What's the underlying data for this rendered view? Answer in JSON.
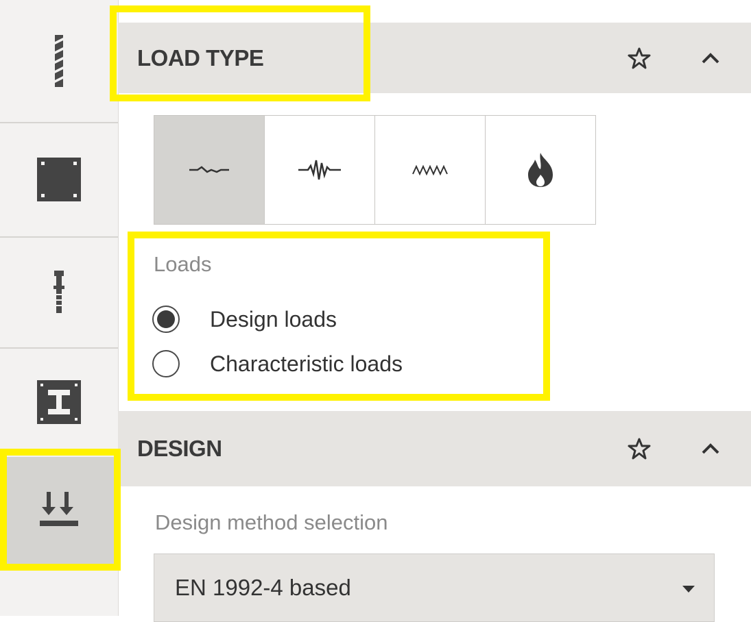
{
  "sidebar": {
    "items": [
      {
        "name": "anchor-icon"
      },
      {
        "name": "base-plate-icon"
      },
      {
        "name": "fastener-icon"
      },
      {
        "name": "profile-icon"
      },
      {
        "name": "loads-icon",
        "active": true
      }
    ]
  },
  "load_type": {
    "title": "LOAD TYPE",
    "buttons": [
      {
        "icon": "static-load-icon",
        "active": true
      },
      {
        "icon": "seismic-load-icon",
        "active": false
      },
      {
        "icon": "fatigue-load-icon",
        "active": false
      },
      {
        "icon": "fire-icon",
        "active": false
      }
    ],
    "loads_label": "Loads",
    "options": [
      {
        "label": "Design loads",
        "selected": true
      },
      {
        "label": "Characteristic loads",
        "selected": false
      }
    ]
  },
  "design": {
    "title": "DESIGN",
    "method_label": "Design method selection",
    "method_value": "EN 1992-4 based"
  },
  "colors": {
    "highlight": "#fff200",
    "header_bg": "#e6e4e1",
    "active_bg": "#d4d3d0"
  }
}
